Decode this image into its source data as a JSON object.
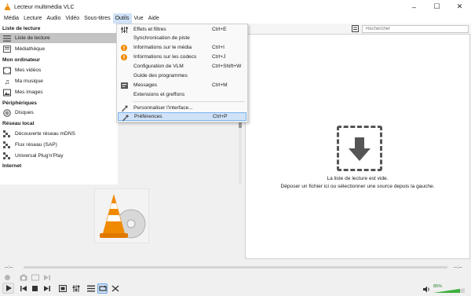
{
  "window": {
    "title": "Lecteur multimédia VLC"
  },
  "menubar": [
    "Média",
    "Lecture",
    "Audio",
    "Vidéo",
    "Sous-titres",
    "Outils",
    "Vue",
    "Aide"
  ],
  "sidebar": {
    "sections": {
      "playlist": "Liste de lecture",
      "computer": "Mon ordinateur",
      "devices": "Périphériques",
      "network": "Réseau local",
      "internet": "Internet"
    },
    "items": {
      "playlist": "Liste de lecture",
      "library": "Médiathèque",
      "videos": "Mes vidéos",
      "music": "Ma musique",
      "images": "Mes images",
      "discs": "Disques",
      "mdns": "Découverte réseau mDNS",
      "sap": "Flux réseau (SAP)",
      "upnp": "Universal Plug'n'Play"
    }
  },
  "search": {
    "placeholder": "Rechercher"
  },
  "tools_menu": {
    "items": [
      {
        "label": "Effets et filtres",
        "shortcut": "Ctrl+E",
        "icon": "sliders-icon"
      },
      {
        "label": "Synchronisation de piste",
        "shortcut": "",
        "icon": ""
      },
      {
        "label": "Informations sur le média",
        "shortcut": "Ctrl+I",
        "icon": "info-icon"
      },
      {
        "label": "Informations sur les codecs",
        "shortcut": "Ctrl+J",
        "icon": "info-icon"
      },
      {
        "label": "Configuration de VLM",
        "shortcut": "Ctrl+Shift+W",
        "icon": ""
      },
      {
        "label": "Guide des programmes",
        "shortcut": "",
        "icon": ""
      },
      {
        "label": "Messages",
        "shortcut": "Ctrl+M",
        "icon": "messages-icon"
      },
      {
        "label": "Extensions et greffons",
        "shortcut": "",
        "icon": ""
      },
      {
        "label": "Personnaliser l'interface...",
        "shortcut": "",
        "icon": "wrench-icon"
      },
      {
        "label": "Préférences",
        "shortcut": "Ctrl+P",
        "icon": "wrench-icon"
      }
    ]
  },
  "playlist_empty": {
    "line1": "La liste de lecture est vide.",
    "line2": "Déposer un fichier ici ou sélectionner une source depuis la gauche."
  },
  "player": {
    "time_elapsed": "--:--",
    "time_remaining": "--:--",
    "volume": "85%",
    "volume_level": 0.85
  },
  "colors": {
    "accent": "#cfe2f7",
    "vlc_orange": "#f08a00",
    "volume_green": "#3db03d"
  }
}
